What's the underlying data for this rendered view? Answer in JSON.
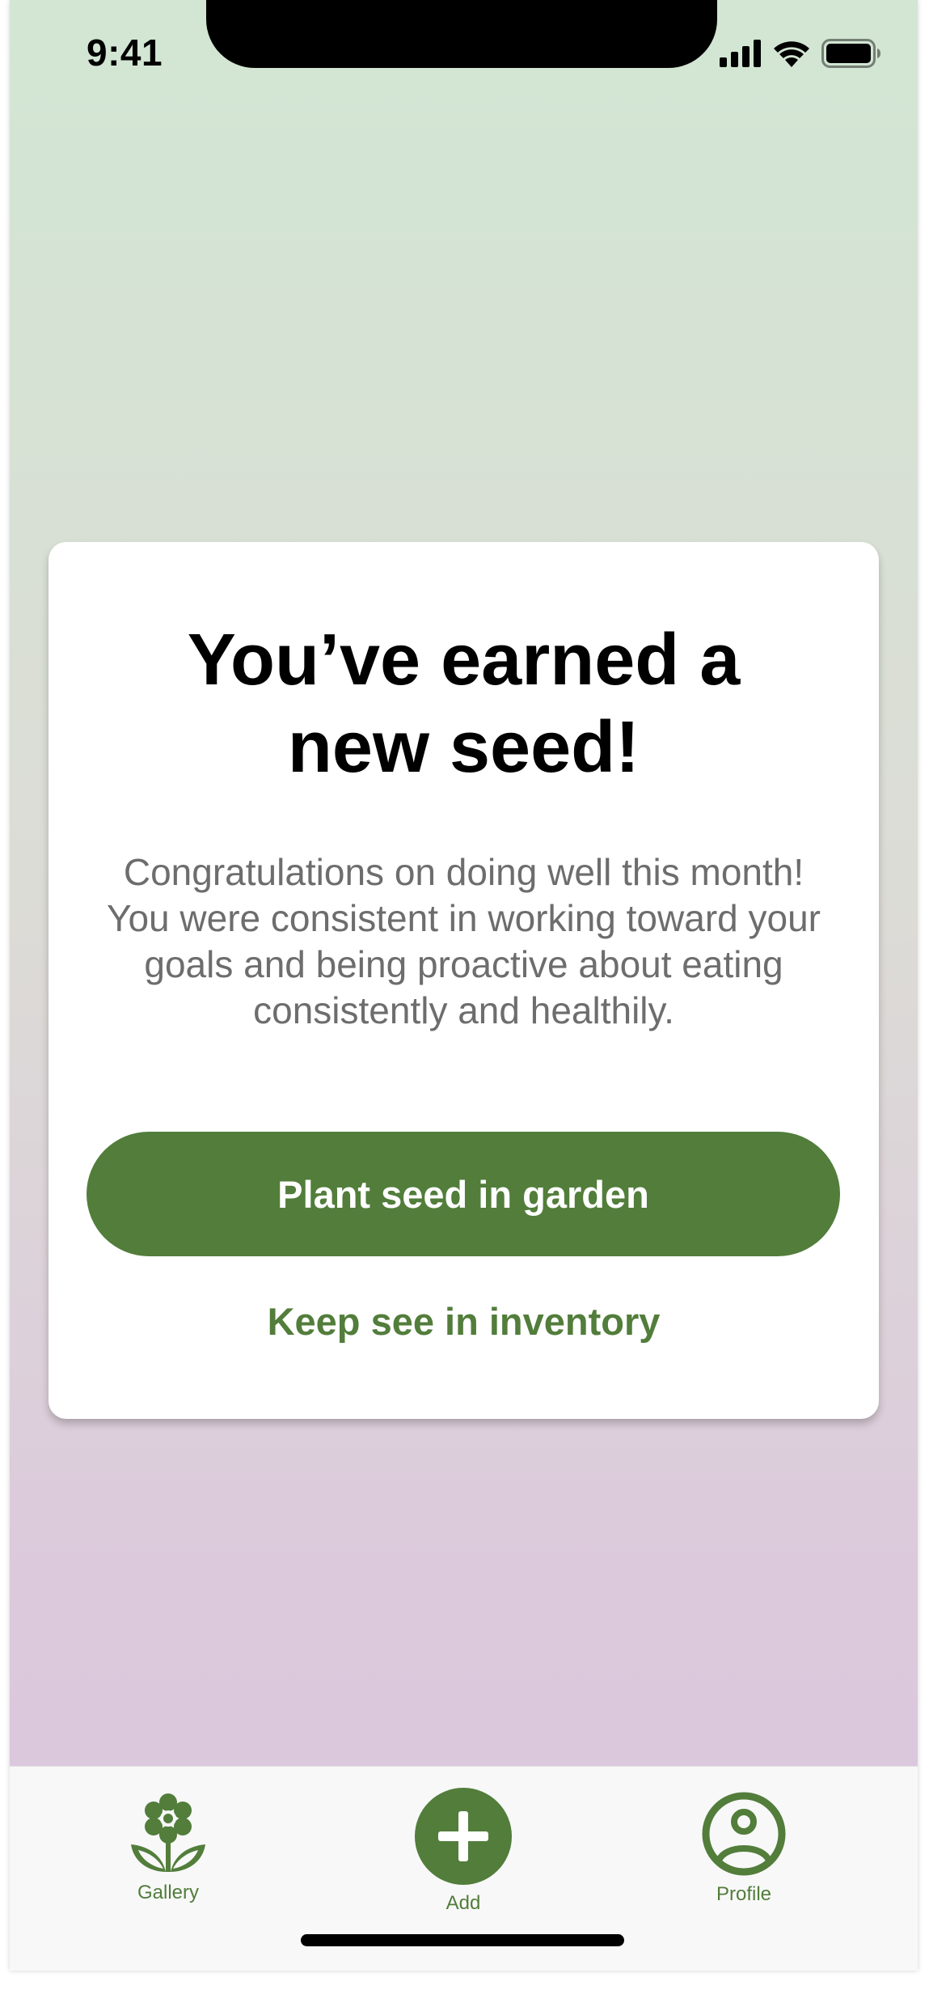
{
  "status_bar": {
    "time": "9:41",
    "icons": [
      "cellular-signal-icon",
      "wifi-icon",
      "battery-icon"
    ]
  },
  "modal": {
    "title_line1": "You’ve earned a",
    "title_line2": "new seed!",
    "body": "Congratulations on doing well this month! You were consistent in working toward your goals and being proactive about eating consistently and healthily.",
    "primary_button": "Plant seed in garden",
    "secondary_link": "Keep see in inventory"
  },
  "tab_bar": {
    "gallery": {
      "label": "Gallery",
      "icon": "flower-icon"
    },
    "add": {
      "label": "Add",
      "icon": "plus-icon"
    },
    "profile": {
      "label": "Profile",
      "icon": "user-circle-icon"
    }
  },
  "colors": {
    "accent": "#527d3b",
    "background_top": "#d2e6d3",
    "background_bottom": "#ddc7de",
    "card": "#ffffff",
    "body_text": "#6d6d6d"
  }
}
